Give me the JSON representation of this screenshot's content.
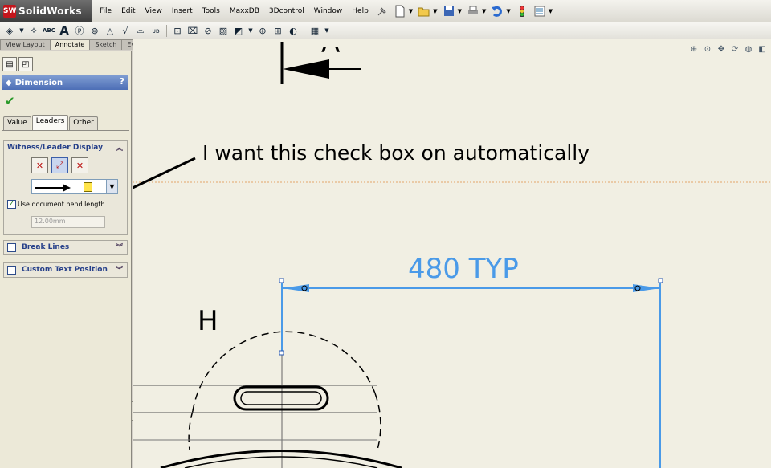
{
  "app": {
    "logo_mark": "SW",
    "name": "SolidWorks"
  },
  "menus": [
    "File",
    "Edit",
    "View",
    "Insert",
    "Tools",
    "MaxxDB",
    "3Dcontrol",
    "Window",
    "Help"
  ],
  "menu_icons": [
    "pin-icon",
    "new-doc-icon",
    "open-icon",
    "save-icon",
    "print-icon",
    "undo-icon",
    "traffic-light-icon",
    "options-icon"
  ],
  "toolbar_icons": [
    "smart-dimension-icon",
    "model-items-icon",
    "spell-check-icon",
    "note-icon",
    "balloon-icon",
    "auto-balloon-icon",
    "surface-finish-icon",
    "weld-symbol-icon",
    "geometric-tolerance-icon",
    "datum-feature-icon",
    "datum-target-icon",
    "hole-callout-icon",
    "revision-symbol-icon",
    "area-hatch-icon",
    "blocks-icon",
    "center-mark-icon",
    "centerline-icon",
    "tables-icon"
  ],
  "command_tabs": [
    "View Layout",
    "Annotate",
    "Sketch",
    "Evaluate"
  ],
  "active_command_tab": "Annotate",
  "panel": {
    "title": "Dimension",
    "help": "?",
    "tabs": [
      "Value",
      "Leaders",
      "Other"
    ],
    "active_tab": "Leaders",
    "witness_group": {
      "title": "Witness/Leader Display",
      "use_doc_bend_label": "Use document bend length",
      "use_doc_bend_checked": true,
      "bend_value": "12.00mm"
    },
    "break_lines": {
      "title": "Break Lines",
      "checked": false
    },
    "custom_text": {
      "title": "Custom Text Position",
      "checked": false
    }
  },
  "view_tools": [
    "zoom-to-fit-icon",
    "zoom-area-icon",
    "pan-icon",
    "rotate-icon",
    "hide-show-icon",
    "display-style-icon"
  ],
  "drawing": {
    "annotation": "I want this check box on automatically",
    "dimension_text": "480 TYP",
    "label_h": "H",
    "label_a": "A"
  },
  "colors": {
    "dimension": "#4a9ae8",
    "panel_header": "#5a78bd",
    "canvas": "#f1efe3"
  }
}
